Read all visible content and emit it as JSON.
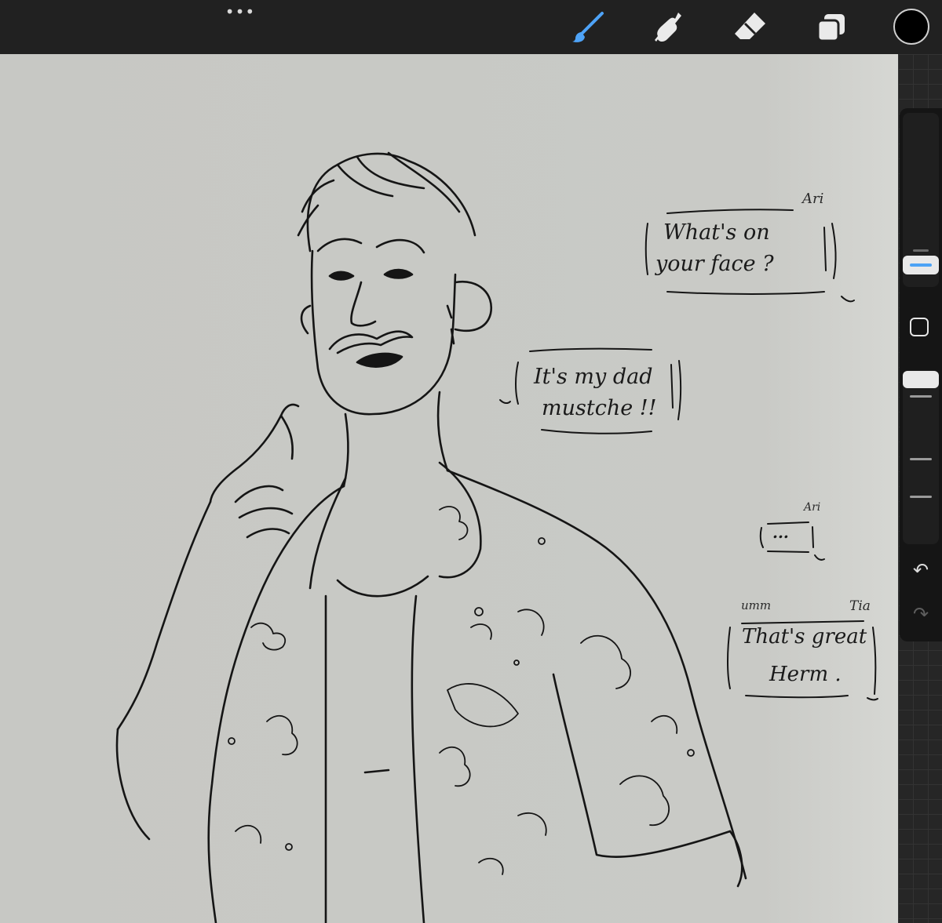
{
  "toolbar": {
    "more_label": "•••",
    "tools": [
      {
        "name": "brush",
        "icon": "brush-icon",
        "active": true,
        "color": "#4ea3f7"
      },
      {
        "name": "smudge",
        "icon": "smudge-icon",
        "active": false
      },
      {
        "name": "eraser",
        "icon": "eraser-icon",
        "active": false
      },
      {
        "name": "layers",
        "icon": "layers-icon",
        "active": false
      }
    ],
    "current_color": "#000000"
  },
  "sidebar": {
    "undo_icon": "undo-icon",
    "redo_icon": "redo-icon",
    "modify_icon": "square-icon"
  },
  "canvas": {
    "bubbles": [
      {
        "speaker": "Ari",
        "line1": "What's on",
        "line2": "your face ?"
      },
      {
        "speaker": "",
        "line1": "It's my dad",
        "line2": "mustche !!"
      },
      {
        "speaker": "Ari",
        "line1": "...",
        "line2": ""
      },
      {
        "speaker": "Tia",
        "aside": "umm",
        "line1": "That's great",
        "line2": "Herm ."
      }
    ]
  }
}
